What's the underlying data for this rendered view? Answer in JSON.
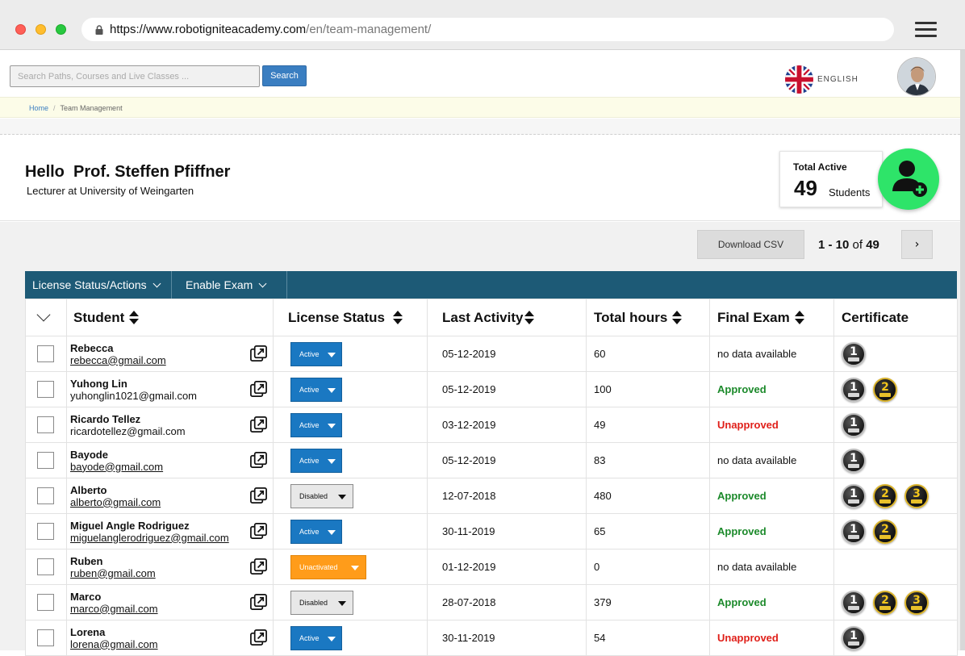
{
  "browser": {
    "url_host": "https://www.robotigniteacademy.com",
    "url_path": "/en/team-management/"
  },
  "header": {
    "search_placeholder": "Search Paths, Courses and Live Classes ...",
    "search_button": "Search",
    "language": "ENGLISH"
  },
  "breadcrumb": {
    "home": "Home",
    "separator": "/",
    "current": "Team Management"
  },
  "profile": {
    "greeting": "Hello  Prof. Steffen Pfiffner",
    "subtitle": "Lecturer at University of Weingarten"
  },
  "stats": {
    "title": "Total Active",
    "count": "49",
    "unit": "Students"
  },
  "toolbar": {
    "download_csv": "Download CSV",
    "pager_range": "1 - 10",
    "pager_of": "of",
    "pager_total": "49",
    "next_symbol": "›"
  },
  "actions": {
    "license_menu": "License Status/Actions",
    "exam_menu": "Enable Exam"
  },
  "table": {
    "columns": [
      "Student",
      "License Status",
      "Last Activity",
      "Total hours",
      "Final Exam",
      "Certificate"
    ],
    "rows": [
      {
        "name": "Rebecca",
        "email": "rebecca@gmail.com",
        "email_underlined": true,
        "status": "Active",
        "last_activity": "05-12-2019",
        "hours": "60",
        "exam": "no data available",
        "exam_state": "none",
        "certs": [
          "1"
        ]
      },
      {
        "name": "Yuhong Lin",
        "email": "yuhonglin1021@gmail.com",
        "email_underlined": false,
        "status": "Active",
        "last_activity": "05-12-2019",
        "hours": "100",
        "exam": "Approved",
        "exam_state": "approved",
        "certs": [
          "1",
          "2"
        ]
      },
      {
        "name": "Ricardo Tellez",
        "email": "ricardotellez@gmail.com",
        "email_underlined": false,
        "status": "Active",
        "last_activity": "03-12-2019",
        "hours": "49",
        "exam": "Unapproved",
        "exam_state": "unapproved",
        "certs": [
          "1"
        ]
      },
      {
        "name": "Bayode",
        "email": "bayode@gmail.com",
        "email_underlined": true,
        "status": "Active",
        "last_activity": "05-12-2019",
        "hours": "83",
        "exam": "no data available",
        "exam_state": "none",
        "certs": [
          "1"
        ]
      },
      {
        "name": "Alberto",
        "email": "alberto@gmail.com",
        "email_underlined": true,
        "status": "Disabled",
        "last_activity": "12-07-2018",
        "hours": "480",
        "exam": "Approved",
        "exam_state": "approved",
        "certs": [
          "1",
          "2",
          "3"
        ]
      },
      {
        "name": "Miguel Angle Rodriguez",
        "email": "miguelanglerodriguez@gmail.com",
        "email_underlined": true,
        "status": "Active",
        "last_activity": "30-11-2019",
        "hours": "65",
        "exam": "Approved",
        "exam_state": "approved",
        "certs": [
          "1",
          "2"
        ]
      },
      {
        "name": "Ruben",
        "email": "ruben@gmail.com",
        "email_underlined": true,
        "status": "Unactivated",
        "last_activity": "01-12-2019",
        "hours": "0",
        "exam": "no data available",
        "exam_state": "none",
        "certs": []
      },
      {
        "name": "Marco",
        "email": "marco@gmail.com",
        "email_underlined": true,
        "status": "Disabled",
        "last_activity": "28-07-2018",
        "hours": "379",
        "exam": "Approved",
        "exam_state": "approved",
        "certs": [
          "1",
          "2",
          "3"
        ]
      },
      {
        "name": "Lorena",
        "email": "lorena@gmail.com",
        "email_underlined": true,
        "status": "Active",
        "last_activity": "30-11-2019",
        "hours": "54",
        "exam": "Unapproved",
        "exam_state": "unapproved",
        "certs": [
          "1"
        ]
      }
    ]
  },
  "colors": {
    "action_bar": "#1d5a76",
    "active_status": "#1a78c2",
    "unactivated_status": "#ff9c1a",
    "approved": "#1c8a2b",
    "unapproved": "#e0201a",
    "add_user": "#2ee469"
  },
  "icons": {
    "lock": "lock-icon",
    "menu": "hamburger-icon",
    "flag": "uk-flag-icon",
    "add_user": "add-user-icon",
    "open_student": "external-link-icon"
  }
}
